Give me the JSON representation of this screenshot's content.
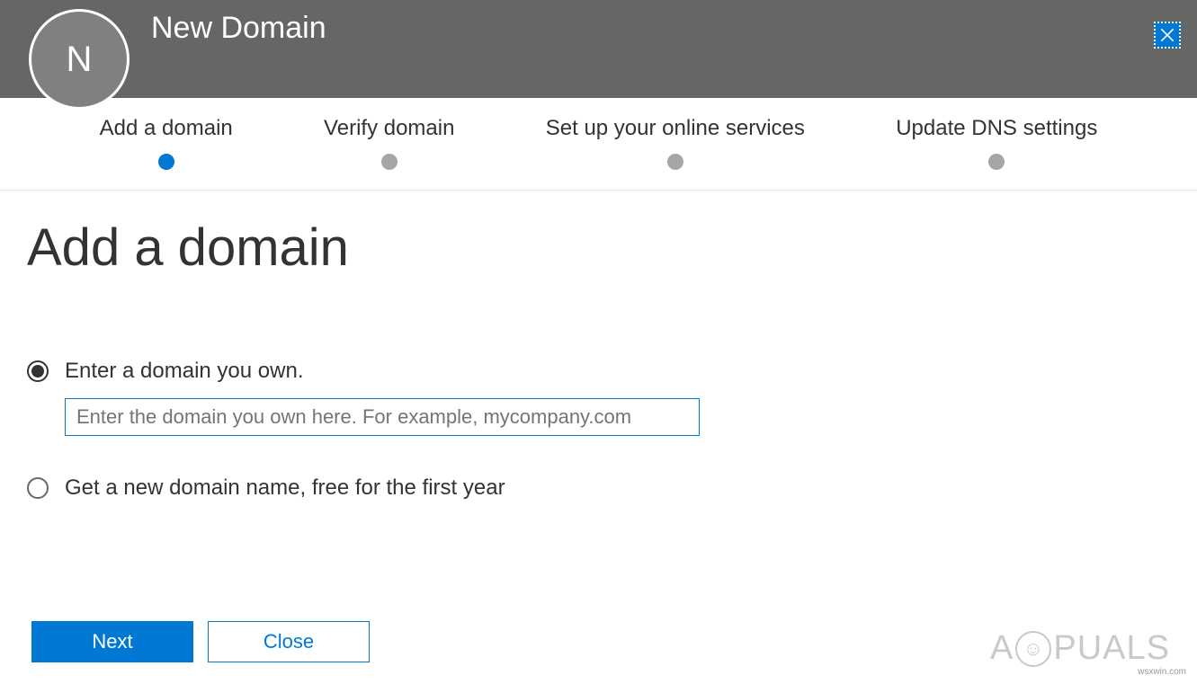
{
  "header": {
    "avatar_letter": "N",
    "title": "New Domain"
  },
  "stepper": {
    "steps": [
      {
        "label": "Add a domain",
        "active": true
      },
      {
        "label": "Verify domain",
        "active": false
      },
      {
        "label": "Set up your online services",
        "active": false
      },
      {
        "label": "Update DNS settings",
        "active": false
      }
    ]
  },
  "content": {
    "title": "Add a domain",
    "option_own": "Enter a domain you own.",
    "domain_placeholder": "Enter the domain you own here. For example, mycompany.com",
    "domain_value": "",
    "option_new": "Get a new domain name, free for the first year"
  },
  "buttons": {
    "next": "Next",
    "close": "Close"
  },
  "watermark": {
    "source": "wsxwin.com",
    "brand_left": "A",
    "brand_right": "PUALS"
  }
}
